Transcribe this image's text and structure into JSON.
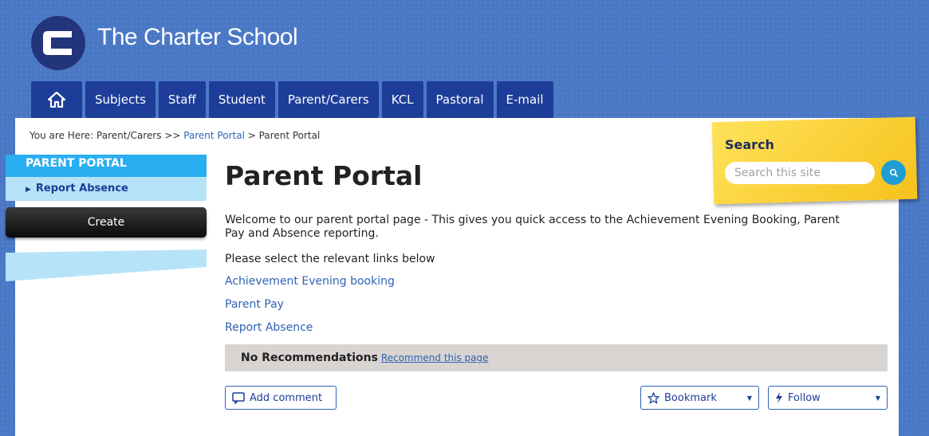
{
  "site": {
    "title": "The Charter School",
    "logo_letter": "C"
  },
  "nav": {
    "home_icon": "home-icon",
    "tabs": [
      "Subjects",
      "Staff",
      "Student",
      "Parent/Carers",
      "KCL",
      "Pastoral",
      "E-mail"
    ]
  },
  "breadcrumb": {
    "prefix": "You are Here: Parent/Carers >> ",
    "link": "Parent Portal",
    "separator": " > ",
    "current": "Parent Portal"
  },
  "leftnav": {
    "heading": "PARENT PORTAL",
    "items": [
      {
        "label": "Report Absence"
      }
    ],
    "create_label": "Create"
  },
  "main": {
    "title": "Parent Portal",
    "intro": "Welcome to our parent portal page - This gives you quick access to the Achievement Evening Booking, Parent Pay and Absence reporting.",
    "select_text": "Please select the relevant links below",
    "links": [
      "Achievement Evening booking",
      "Parent Pay",
      "Report Absence"
    ]
  },
  "recommend": {
    "status": "No Recommendations",
    "link": "Recommend this page"
  },
  "actions": {
    "add_comment": "Add comment",
    "bookmark": "Bookmark",
    "follow": "Follow"
  },
  "search": {
    "label": "Search",
    "placeholder": "Search this site"
  },
  "colors": {
    "nav_tab": "#1d3d98",
    "accent_blue": "#29aef0",
    "link": "#2e63b5",
    "search_note": "#f5c21d"
  }
}
